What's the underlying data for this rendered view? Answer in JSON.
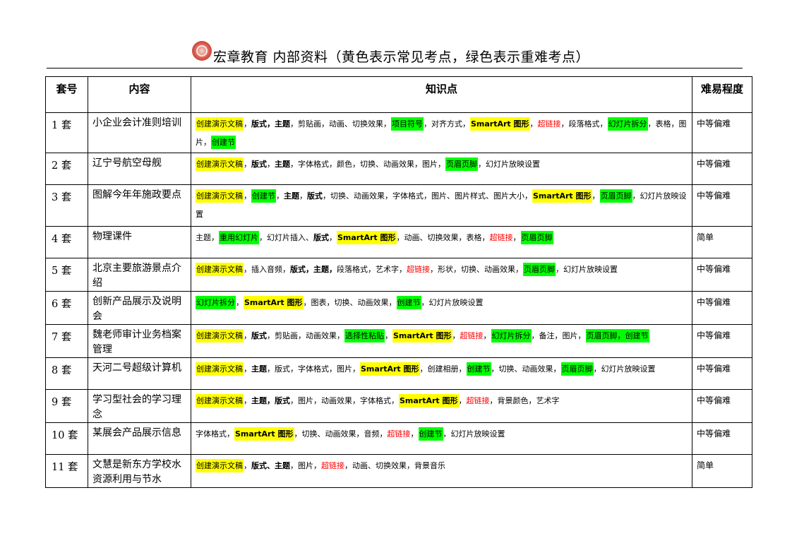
{
  "header": {
    "title": "宏章教育  内部资料（黄色表示常见考点，绿色表示重难考点）",
    "logo_text": "宏章"
  },
  "table": {
    "headers": [
      "套号",
      "内容",
      "知识点",
      "难易程度"
    ],
    "rows": [
      {
        "set": "1 套",
        "title": "小企业会计准则培训",
        "difficulty": "中等偏难",
        "height": 57,
        "kp": [
          {
            "t": "创建演示文稿",
            "s": "y"
          },
          {
            "t": "，"
          },
          {
            "t": "版式，主题",
            "s": "b"
          },
          {
            "t": "，剪贴画，动画、切换效果，"
          },
          {
            "t": "项目符号",
            "s": "g"
          },
          {
            "t": "，对齐方式，"
          },
          {
            "t": "SmartArt 图形",
            "s": "yb"
          },
          {
            "t": "，"
          },
          {
            "t": "超链接",
            "s": "r"
          },
          {
            "t": "，段落格式，"
          },
          {
            "t": "幻灯片拆分",
            "s": "g"
          },
          {
            "t": "，表格，图片，"
          },
          {
            "t": "创建节",
            "s": "g"
          }
        ]
      },
      {
        "set": "2 套",
        "title": "辽宁号航空母舰",
        "difficulty": "中等偏难",
        "height": 45,
        "kp": [
          {
            "t": "创建演示文稿",
            "s": "y"
          },
          {
            "t": "，"
          },
          {
            "t": "版式",
            "s": "b"
          },
          {
            "t": "，"
          },
          {
            "t": "主题",
            "s": "b"
          },
          {
            "t": "，字体格式，颜色，切换、动画效果，图片，"
          },
          {
            "t": "页眉页脚",
            "s": "g"
          },
          {
            "t": "，幻灯片放映设置"
          }
        ]
      },
      {
        "set": "3 套",
        "title": "图解今年年施政要点",
        "difficulty": "中等偏难",
        "height": 59,
        "kp": [
          {
            "t": "创建演示文稿",
            "s": "y"
          },
          {
            "t": "，"
          },
          {
            "t": "创建节",
            "s": "g"
          },
          {
            "t": "，"
          },
          {
            "t": "主题",
            "s": "b"
          },
          {
            "t": "，"
          },
          {
            "t": "版式",
            "s": "b"
          },
          {
            "t": "，切换、动画效果，字体格式，图片、图片样式、图片大小，"
          },
          {
            "t": "SmartArt 图形",
            "s": "yb"
          },
          {
            "t": "，"
          },
          {
            "t": "页眉页脚",
            "s": "g"
          },
          {
            "t": "，幻灯片放映设置"
          }
        ]
      },
      {
        "set": "4 套",
        "title": "物理课件",
        "difficulty": "简单",
        "height": 45,
        "kp": [
          {
            "t": "主题，"
          },
          {
            "t": "重用幻灯片",
            "s": "g"
          },
          {
            "t": "，幻灯片插入、"
          },
          {
            "t": "版式",
            "s": "b"
          },
          {
            "t": "，"
          },
          {
            "t": "SmartArt 图形",
            "s": "yb"
          },
          {
            "t": "，动画、切换效果，表格，"
          },
          {
            "t": "超链接",
            "s": "r"
          },
          {
            "t": "，"
          },
          {
            "t": "页眉页脚",
            "s": "g"
          }
        ]
      },
      {
        "set": "5 套",
        "title": "北京主要旅游景点介绍",
        "difficulty": "中等偏难",
        "height": 45,
        "kp": [
          {
            "t": "创建演示文稿",
            "s": "y"
          },
          {
            "t": "，插入音频，"
          },
          {
            "t": "版式，主题，",
            "s": "b"
          },
          {
            "t": "段落格式，艺术字，"
          },
          {
            "t": "超链接",
            "s": "r"
          },
          {
            "t": "，形状，切换、动画效果，"
          },
          {
            "t": "页眉页脚",
            "s": "g"
          },
          {
            "t": "，幻灯片放映设置"
          }
        ]
      },
      {
        "set": "6 套",
        "title": "创新产品展示及说明会",
        "difficulty": "中等偏难",
        "height": 45,
        "kp": [
          {
            "t": "幻灯片拆分",
            "s": "g"
          },
          {
            "t": "，"
          },
          {
            "t": "SmartArt 图形",
            "s": "yb"
          },
          {
            "t": "，图表，切换、动画效果，"
          },
          {
            "t": "创建节",
            "s": "g"
          },
          {
            "t": "，幻灯片放映设置"
          }
        ]
      },
      {
        "set": "7 套",
        "title": "魏老师审计业务档案管理",
        "difficulty": "中等偏难",
        "height": 45,
        "kp": [
          {
            "t": "创建演示文稿",
            "s": "y"
          },
          {
            "t": "，"
          },
          {
            "t": "版式",
            "s": "b"
          },
          {
            "t": "，剪贴画，动画效果，"
          },
          {
            "t": "选择性粘贴",
            "s": "g"
          },
          {
            "t": "，"
          },
          {
            "t": "SmartArt 图形",
            "s": "yb"
          },
          {
            "t": "，"
          },
          {
            "t": "超链接",
            "s": "r"
          },
          {
            "t": "，"
          },
          {
            "t": "幻灯片拆分",
            "s": "g"
          },
          {
            "t": "，备注，图片，"
          },
          {
            "t": "页眉页脚，创建节",
            "s": "g"
          }
        ]
      },
      {
        "set": "8 套",
        "title": "天河二号超级计算机",
        "difficulty": "中等偏难",
        "height": 45,
        "kp": [
          {
            "t": "创建演示文稿",
            "s": "y"
          },
          {
            "t": "，"
          },
          {
            "t": "主题",
            "s": "b"
          },
          {
            "t": "，版式，字体格式，图片，"
          },
          {
            "t": "SmartArt 图形",
            "s": "yb"
          },
          {
            "t": "，创建相册，"
          },
          {
            "t": "创建节",
            "s": "g"
          },
          {
            "t": "，切换、动画效果，"
          },
          {
            "t": "页眉页脚",
            "s": "g"
          },
          {
            "t": "，幻灯片放映设置"
          }
        ]
      },
      {
        "set": "9 套",
        "title": "学习型社会的学习理念",
        "difficulty": "中等偏难",
        "height": 45,
        "kp": [
          {
            "t": "创建演示文稿",
            "s": "y"
          },
          {
            "t": "，"
          },
          {
            "t": "主题，版式",
            "s": "b"
          },
          {
            "t": "，图片，动画效果，字体格式，"
          },
          {
            "t": "SmartArt 图形",
            "s": "yb"
          },
          {
            "t": "，"
          },
          {
            "t": "超链接",
            "s": "r"
          },
          {
            "t": "，背景颜色，艺术字"
          }
        ]
      },
      {
        "set": "10 套",
        "title": "某展会产品展示信息",
        "difficulty": "中等偏难",
        "height": 45,
        "kp": [
          {
            "t": "字体格式，"
          },
          {
            "t": "SmartArt 图形",
            "s": "yb"
          },
          {
            "t": "，切换、动画效果，音频，"
          },
          {
            "t": "超链接",
            "s": "r"
          },
          {
            "t": "，"
          },
          {
            "t": "创建节",
            "s": "g"
          },
          {
            "t": "，幻灯片放映设置"
          }
        ]
      },
      {
        "set": "11 套",
        "title": "文慧是新东方学校水资源利用与节水",
        "difficulty": "简单",
        "height": 45,
        "kp": [
          {
            "t": "创建演示文稿",
            "s": "y"
          },
          {
            "t": "，"
          },
          {
            "t": "版式、主题",
            "s": "b"
          },
          {
            "t": "，图片，"
          },
          {
            "t": "超链接",
            "s": "r"
          },
          {
            "t": "，动画、切换效果，背景音乐"
          }
        ]
      }
    ]
  }
}
